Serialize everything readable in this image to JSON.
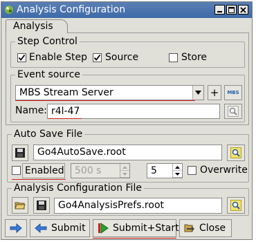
{
  "window": {
    "title": "Analysis Configuration"
  },
  "tabs": [
    {
      "label": "Analysis"
    }
  ],
  "step_control": {
    "title": "Step Control",
    "enable_step": {
      "label": "Enable Step",
      "checked": true
    },
    "source": {
      "label": "Source",
      "checked": true
    },
    "store": {
      "label": "Store",
      "checked": false
    }
  },
  "event_source": {
    "title": "Event source",
    "type_value": "MBS Stream Server",
    "add_label": "+",
    "mbs_label": "MBS",
    "name_label": "Name:",
    "name_value": "r4l-47"
  },
  "auto_save": {
    "title": "Auto Save File",
    "file_value": "Go4AutoSave.root",
    "enabled_label": "Enabled",
    "enabled_checked": false,
    "interval_value": "500 s",
    "compression_value": "5",
    "overwrite_label": "Overwrite",
    "overwrite_checked": false
  },
  "config_file": {
    "title": "Analysis Configuration File",
    "file_value": "Go4AnalysisPrefs.root"
  },
  "buttons": {
    "submit": "Submit",
    "submit_start": "Submit+Start",
    "close": "Close"
  },
  "colors": {
    "titlebar": "#4a74ae",
    "accent_red": "#d02020",
    "panel": "#e0dfd8"
  }
}
